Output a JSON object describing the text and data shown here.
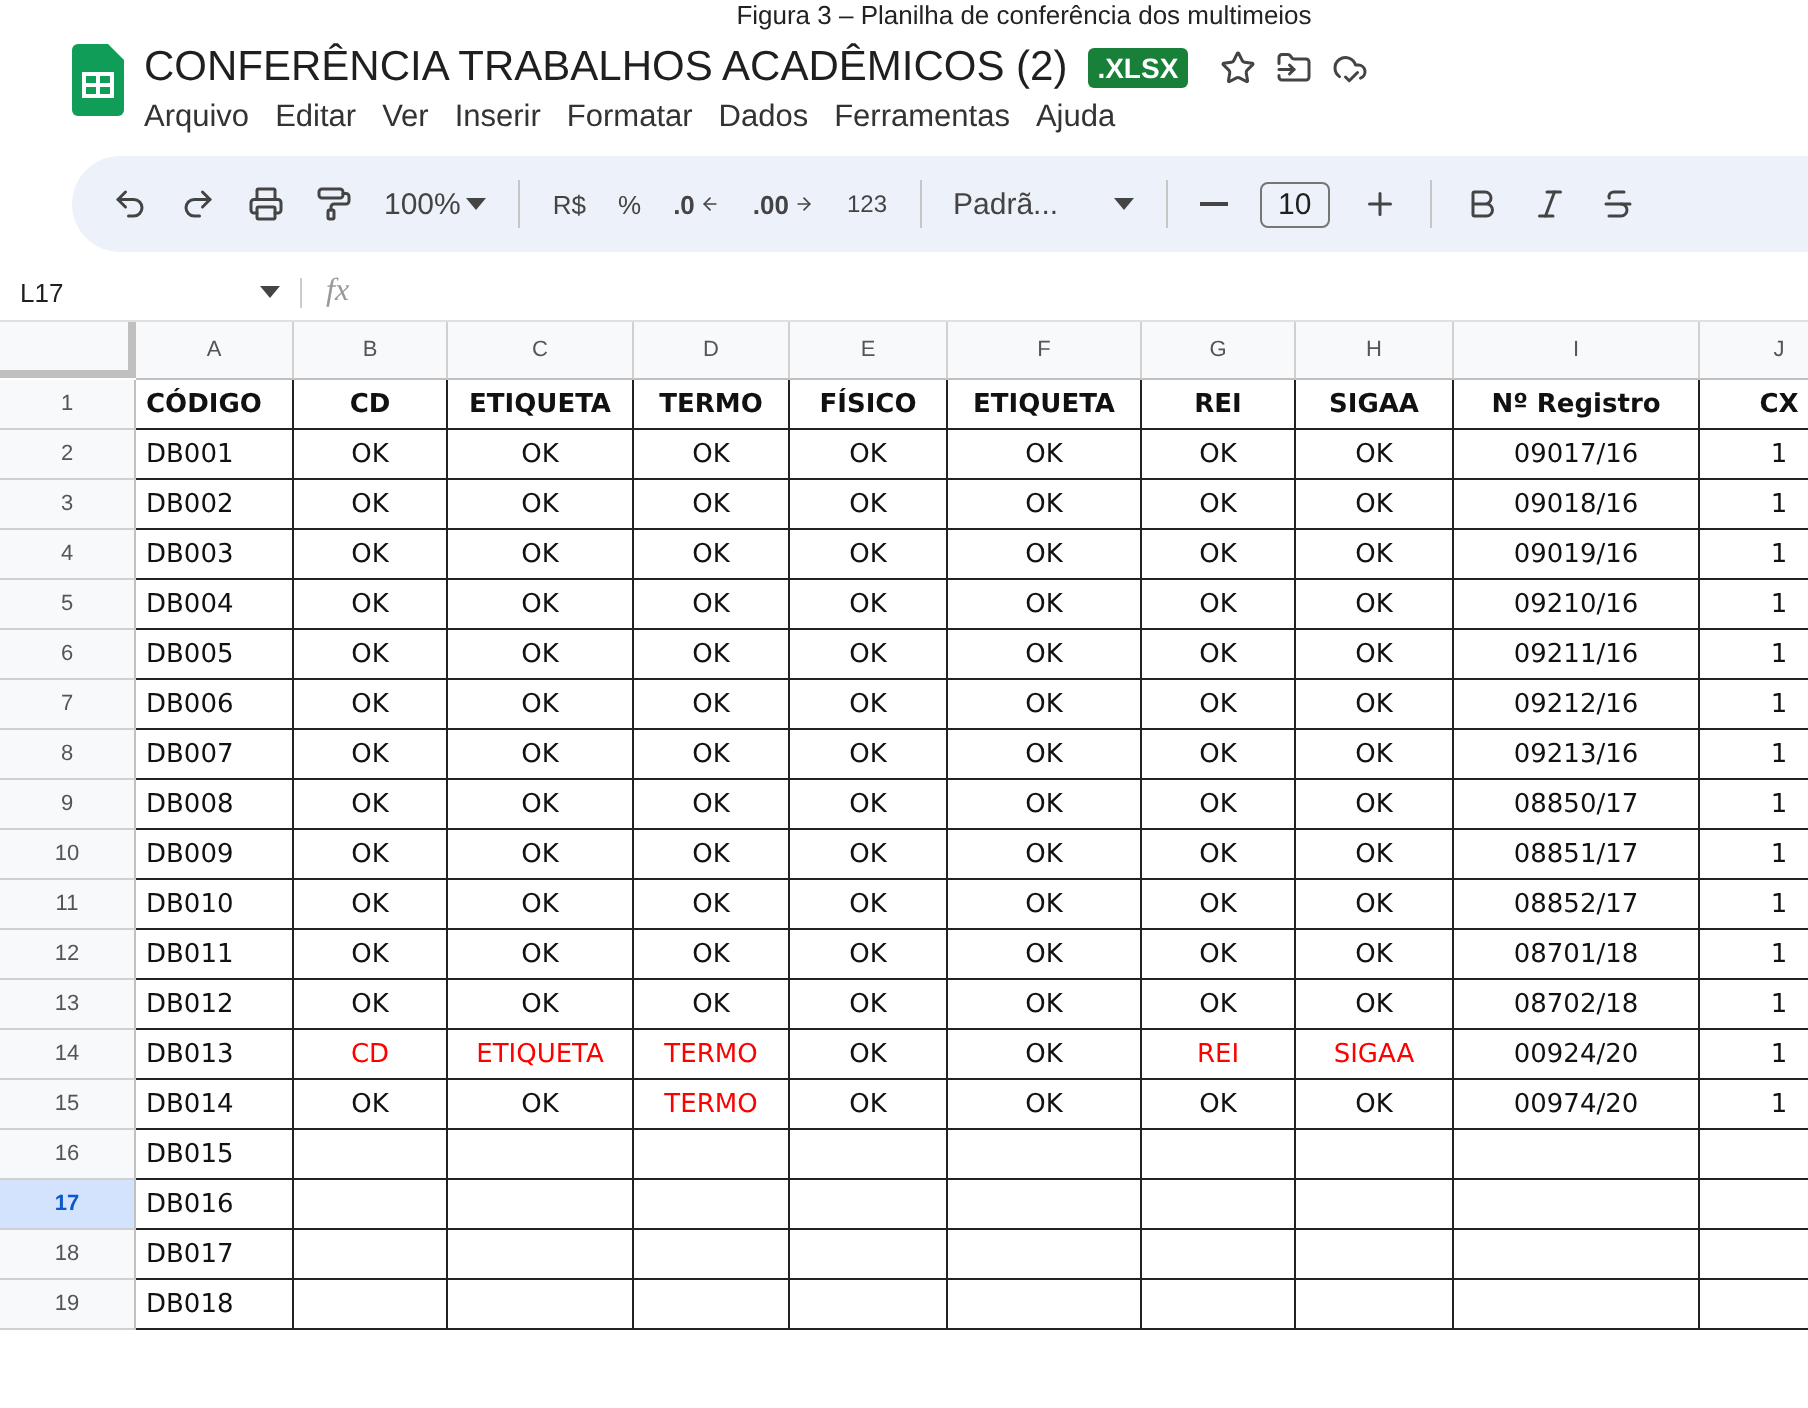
{
  "caption": "Figura 3 – Planilha de conferência dos multimeios",
  "document": {
    "title": "CONFERÊNCIA TRABALHOS ACADÊMICOS (2)",
    "badge": ".XLSX"
  },
  "menu": [
    "Arquivo",
    "Editar",
    "Ver",
    "Inserir",
    "Formatar",
    "Dados",
    "Ferramentas",
    "Ajuda"
  ],
  "toolbar": {
    "zoom": "100%",
    "currency": "R$",
    "percent": "%",
    "decrease_decimals": ".0",
    "increase_decimals": ".00",
    "number_format": "123",
    "font": "Padrã...",
    "font_size": "10"
  },
  "formula_bar": {
    "cell_ref": "L17",
    "fx": "fx"
  },
  "columns": [
    "A",
    "B",
    "C",
    "D",
    "E",
    "F",
    "G",
    "H",
    "I",
    "J"
  ],
  "rows": [
    {
      "number": "1",
      "selected": false,
      "header": true,
      "cells": [
        {
          "text": "CÓDIGO",
          "flagged": false
        },
        {
          "text": "CD",
          "flagged": false
        },
        {
          "text": "ETIQUETA",
          "flagged": false
        },
        {
          "text": "TERMO",
          "flagged": false
        },
        {
          "text": "FÍSICO",
          "flagged": false
        },
        {
          "text": "ETIQUETA",
          "flagged": false
        },
        {
          "text": "REI",
          "flagged": false
        },
        {
          "text": "SIGAA",
          "flagged": false
        },
        {
          "text": "Nº Registro",
          "flagged": false
        },
        {
          "text": "CX",
          "flagged": false
        }
      ]
    },
    {
      "number": "2",
      "selected": false,
      "header": false,
      "cells": [
        {
          "text": "DB001",
          "flagged": false
        },
        {
          "text": "OK",
          "flagged": false
        },
        {
          "text": "OK",
          "flagged": false
        },
        {
          "text": "OK",
          "flagged": false
        },
        {
          "text": "OK",
          "flagged": false
        },
        {
          "text": "OK",
          "flagged": false
        },
        {
          "text": "OK",
          "flagged": false
        },
        {
          "text": "OK",
          "flagged": false
        },
        {
          "text": "09017/16",
          "flagged": false
        },
        {
          "text": "1",
          "flagged": false
        }
      ]
    },
    {
      "number": "3",
      "selected": false,
      "header": false,
      "cells": [
        {
          "text": "DB002",
          "flagged": false
        },
        {
          "text": "OK",
          "flagged": false
        },
        {
          "text": "OK",
          "flagged": false
        },
        {
          "text": "OK",
          "flagged": false
        },
        {
          "text": "OK",
          "flagged": false
        },
        {
          "text": "OK",
          "flagged": false
        },
        {
          "text": "OK",
          "flagged": false
        },
        {
          "text": "OK",
          "flagged": false
        },
        {
          "text": "09018/16",
          "flagged": false
        },
        {
          "text": "1",
          "flagged": false
        }
      ]
    },
    {
      "number": "4",
      "selected": false,
      "header": false,
      "cells": [
        {
          "text": "DB003",
          "flagged": false
        },
        {
          "text": "OK",
          "flagged": false
        },
        {
          "text": "OK",
          "flagged": false
        },
        {
          "text": "OK",
          "flagged": false
        },
        {
          "text": "OK",
          "flagged": false
        },
        {
          "text": "OK",
          "flagged": false
        },
        {
          "text": "OK",
          "flagged": false
        },
        {
          "text": "OK",
          "flagged": false
        },
        {
          "text": "09019/16",
          "flagged": false
        },
        {
          "text": "1",
          "flagged": false
        }
      ]
    },
    {
      "number": "5",
      "selected": false,
      "header": false,
      "cells": [
        {
          "text": "DB004",
          "flagged": false
        },
        {
          "text": "OK",
          "flagged": false
        },
        {
          "text": "OK",
          "flagged": false
        },
        {
          "text": "OK",
          "flagged": false
        },
        {
          "text": "OK",
          "flagged": false
        },
        {
          "text": "OK",
          "flagged": false
        },
        {
          "text": "OK",
          "flagged": false
        },
        {
          "text": "OK",
          "flagged": false
        },
        {
          "text": "09210/16",
          "flagged": false
        },
        {
          "text": "1",
          "flagged": false
        }
      ]
    },
    {
      "number": "6",
      "selected": false,
      "header": false,
      "cells": [
        {
          "text": "DB005",
          "flagged": false
        },
        {
          "text": "OK",
          "flagged": false
        },
        {
          "text": "OK",
          "flagged": false
        },
        {
          "text": "OK",
          "flagged": false
        },
        {
          "text": "OK",
          "flagged": false
        },
        {
          "text": "OK",
          "flagged": false
        },
        {
          "text": "OK",
          "flagged": false
        },
        {
          "text": "OK",
          "flagged": false
        },
        {
          "text": "09211/16",
          "flagged": false
        },
        {
          "text": "1",
          "flagged": false
        }
      ]
    },
    {
      "number": "7",
      "selected": false,
      "header": false,
      "cells": [
        {
          "text": "DB006",
          "flagged": false
        },
        {
          "text": "OK",
          "flagged": false
        },
        {
          "text": "OK",
          "flagged": false
        },
        {
          "text": "OK",
          "flagged": false
        },
        {
          "text": "OK",
          "flagged": false
        },
        {
          "text": "OK",
          "flagged": false
        },
        {
          "text": "OK",
          "flagged": false
        },
        {
          "text": "OK",
          "flagged": false
        },
        {
          "text": "09212/16",
          "flagged": false
        },
        {
          "text": "1",
          "flagged": false
        }
      ]
    },
    {
      "number": "8",
      "selected": false,
      "header": false,
      "cells": [
        {
          "text": "DB007",
          "flagged": false
        },
        {
          "text": "OK",
          "flagged": false
        },
        {
          "text": "OK",
          "flagged": false
        },
        {
          "text": "OK",
          "flagged": false
        },
        {
          "text": "OK",
          "flagged": false
        },
        {
          "text": "OK",
          "flagged": false
        },
        {
          "text": "OK",
          "flagged": false
        },
        {
          "text": "OK",
          "flagged": false
        },
        {
          "text": "09213/16",
          "flagged": false
        },
        {
          "text": "1",
          "flagged": false
        }
      ]
    },
    {
      "number": "9",
      "selected": false,
      "header": false,
      "cells": [
        {
          "text": "DB008",
          "flagged": false
        },
        {
          "text": "OK",
          "flagged": false
        },
        {
          "text": "OK",
          "flagged": false
        },
        {
          "text": "OK",
          "flagged": false
        },
        {
          "text": "OK",
          "flagged": false
        },
        {
          "text": "OK",
          "flagged": false
        },
        {
          "text": "OK",
          "flagged": false
        },
        {
          "text": "OK",
          "flagged": false
        },
        {
          "text": "08850/17",
          "flagged": false
        },
        {
          "text": "1",
          "flagged": false
        }
      ]
    },
    {
      "number": "10",
      "selected": false,
      "header": false,
      "cells": [
        {
          "text": "DB009",
          "flagged": false
        },
        {
          "text": "OK",
          "flagged": false
        },
        {
          "text": "OK",
          "flagged": false
        },
        {
          "text": "OK",
          "flagged": false
        },
        {
          "text": "OK",
          "flagged": false
        },
        {
          "text": "OK",
          "flagged": false
        },
        {
          "text": "OK",
          "flagged": false
        },
        {
          "text": "OK",
          "flagged": false
        },
        {
          "text": "08851/17",
          "flagged": false
        },
        {
          "text": "1",
          "flagged": false
        }
      ]
    },
    {
      "number": "11",
      "selected": false,
      "header": false,
      "cells": [
        {
          "text": "DB010",
          "flagged": false
        },
        {
          "text": "OK",
          "flagged": false
        },
        {
          "text": "OK",
          "flagged": false
        },
        {
          "text": "OK",
          "flagged": false
        },
        {
          "text": "OK",
          "flagged": false
        },
        {
          "text": "OK",
          "flagged": false
        },
        {
          "text": "OK",
          "flagged": false
        },
        {
          "text": "OK",
          "flagged": false
        },
        {
          "text": "08852/17",
          "flagged": false
        },
        {
          "text": "1",
          "flagged": false
        }
      ]
    },
    {
      "number": "12",
      "selected": false,
      "header": false,
      "cells": [
        {
          "text": "DB011",
          "flagged": false
        },
        {
          "text": "OK",
          "flagged": false
        },
        {
          "text": "OK",
          "flagged": false
        },
        {
          "text": "OK",
          "flagged": false
        },
        {
          "text": "OK",
          "flagged": false
        },
        {
          "text": "OK",
          "flagged": false
        },
        {
          "text": "OK",
          "flagged": false
        },
        {
          "text": "OK",
          "flagged": false
        },
        {
          "text": "08701/18",
          "flagged": false
        },
        {
          "text": "1",
          "flagged": false
        }
      ]
    },
    {
      "number": "13",
      "selected": false,
      "header": false,
      "cells": [
        {
          "text": "DB012",
          "flagged": false
        },
        {
          "text": "OK",
          "flagged": false
        },
        {
          "text": "OK",
          "flagged": false
        },
        {
          "text": "OK",
          "flagged": false
        },
        {
          "text": "OK",
          "flagged": false
        },
        {
          "text": "OK",
          "flagged": false
        },
        {
          "text": "OK",
          "flagged": false
        },
        {
          "text": "OK",
          "flagged": false
        },
        {
          "text": "08702/18",
          "flagged": false
        },
        {
          "text": "1",
          "flagged": false
        }
      ]
    },
    {
      "number": "14",
      "selected": false,
      "header": false,
      "cells": [
        {
          "text": "DB013",
          "flagged": false
        },
        {
          "text": "CD",
          "flagged": true
        },
        {
          "text": "ETIQUETA",
          "flagged": true
        },
        {
          "text": "TERMO",
          "flagged": true
        },
        {
          "text": "OK",
          "flagged": false
        },
        {
          "text": "OK",
          "flagged": false
        },
        {
          "text": "REI",
          "flagged": true
        },
        {
          "text": "SIGAA",
          "flagged": true
        },
        {
          "text": "00924/20",
          "flagged": false
        },
        {
          "text": "1",
          "flagged": false
        }
      ]
    },
    {
      "number": "15",
      "selected": false,
      "header": false,
      "cells": [
        {
          "text": "DB014",
          "flagged": false
        },
        {
          "text": "OK",
          "flagged": false
        },
        {
          "text": "OK",
          "flagged": false
        },
        {
          "text": "TERMO",
          "flagged": true
        },
        {
          "text": "OK",
          "flagged": false
        },
        {
          "text": "OK",
          "flagged": false
        },
        {
          "text": "OK",
          "flagged": false
        },
        {
          "text": "OK",
          "flagged": false
        },
        {
          "text": "00974/20",
          "flagged": false
        },
        {
          "text": "1",
          "flagged": false
        }
      ]
    },
    {
      "number": "16",
      "selected": false,
      "header": false,
      "cells": [
        {
          "text": "DB015",
          "flagged": false
        }
      ]
    },
    {
      "number": "17",
      "selected": true,
      "header": false,
      "cells": [
        {
          "text": "DB016",
          "flagged": false
        }
      ]
    },
    {
      "number": "18",
      "selected": false,
      "header": false,
      "cells": [
        {
          "text": "DB017",
          "flagged": false
        }
      ]
    },
    {
      "number": "19",
      "selected": false,
      "header": false,
      "cells": [
        {
          "text": "DB018",
          "flagged": false
        }
      ]
    }
  ]
}
